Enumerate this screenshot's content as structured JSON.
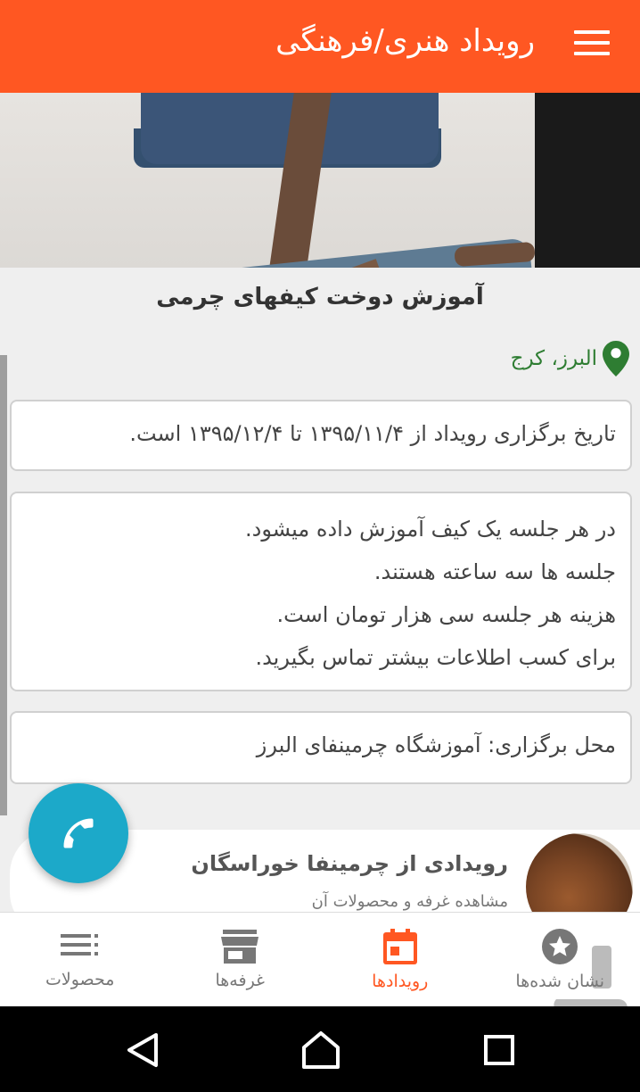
{
  "appbar": {
    "title": "رویداد هنری/فرهنگی",
    "menu_icon": "menu-icon"
  },
  "event": {
    "title": "آموزش دوخت کیفهای چرمی",
    "location": "البرز، کرج",
    "date_text": "تاریخ برگزاری رویداد از ۱۳۹۵/۱۱/۴ تا ۱۳۹۵/۱۲/۴ است.",
    "description": [
      "در هر جلسه یک کیف آموزش داده میشود.",
      "جلسه ها سه ساعته هستند.",
      "هزینه هر جلسه سی هزار تومان است.",
      "برای کسب اطلاعات بیشتر تماس بگیرید."
    ],
    "venue_text": "محل برگزاری: آموزشگاه چرمینفای البرز"
  },
  "promo": {
    "title": "رویدادی از چرمینفا خوراسگان",
    "subtitle": "مشاهده غرفه و محصولات آن"
  },
  "bottom_nav": [
    {
      "label": "محصولات",
      "icon": "list-icon",
      "active": false
    },
    {
      "label": "غرفه‌ها",
      "icon": "store-icon",
      "active": false
    },
    {
      "label": "رویدادها",
      "icon": "calendar-icon",
      "active": true
    },
    {
      "label": "نشان شده‌ها",
      "icon": "star-icon",
      "active": false
    }
  ],
  "colors": {
    "primary": "#ff5722",
    "fab": "#1ca9c9",
    "location": "#2e7d32"
  }
}
